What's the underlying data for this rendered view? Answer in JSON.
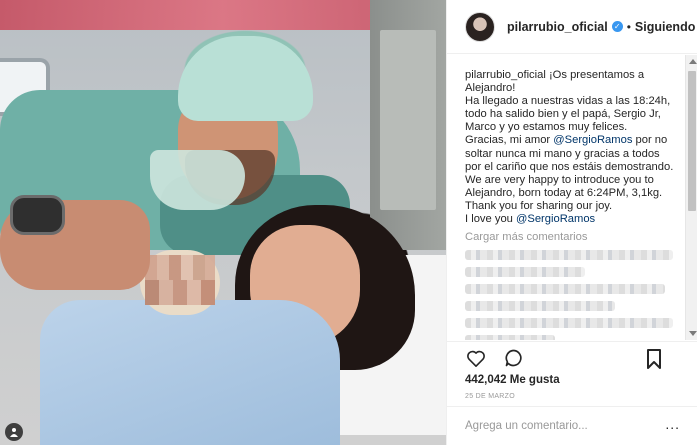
{
  "post": {
    "header": {
      "username": "pilarrubio_oficial",
      "separator": "•",
      "follow_label": "Siguiendo"
    },
    "caption": {
      "username": "pilarrubio_oficial",
      "text_1": " ¡Os presentamos a Alejandro!\nHa llegado a nuestras vidas a las 18:24h, todo ha salido bien y el papá, Sergio Jr, Marco y yo estamos muy felices.\nGracias, mi amor ",
      "mention_1": "@SergioRamos",
      "text_2": " por no soltar nunca mi mano y gracias a todos por el cariño que nos estáis demostrando.\nWe are very happy to introduce you to Alejandro, born today at 6:24PM, 3,1kg.\nThank you for sharing our joy.\nI love you ",
      "mention_2": "@SergioRamos"
    },
    "load_more_label": "Cargar más comentarios",
    "likes": "442,042 Me gusta",
    "date": "25 DE MARZO",
    "add_comment_placeholder": "Agrega un comentario...",
    "more_options": "..."
  },
  "icons": {
    "verified": "verified-badge-icon",
    "like": "heart-icon",
    "comment": "comment-bubble-icon",
    "save": "bookmark-icon",
    "tag": "user-tag-icon"
  },
  "colors": {
    "verified_blue": "#3897f0",
    "mention": "#003569",
    "muted": "#999999"
  }
}
